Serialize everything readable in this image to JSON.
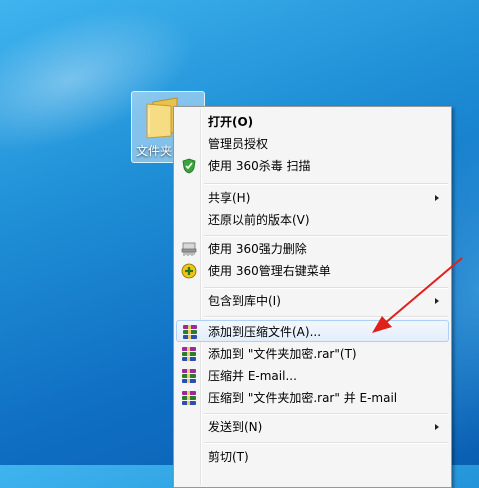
{
  "desktop": {
    "folder_label": "文件夹"
  },
  "menu": {
    "items": [
      {
        "label": "打开(O)",
        "bold": true,
        "icon": ""
      },
      {
        "label": "管理员授权",
        "icon": ""
      },
      {
        "label": "使用 360杀毒 扫描",
        "icon": "360-shield-icon"
      },
      {
        "label": "共享(H)",
        "icon": "",
        "submenu": true
      },
      {
        "label": "还原以前的版本(V)",
        "icon": ""
      },
      {
        "label": "使用 360强力删除",
        "icon": "360-shredder-icon"
      },
      {
        "label": "使用 360管理右键菜单",
        "icon": "360-menu-manager-icon"
      },
      {
        "label": "包含到库中(I)",
        "icon": "",
        "submenu": true
      },
      {
        "label": "添加到压缩文件(A)...",
        "icon": "winrar-icon",
        "highlighted": true
      },
      {
        "label": "添加到 \"文件夹加密.rar\"(T)",
        "icon": "winrar-icon"
      },
      {
        "label": "压缩并 E-mail...",
        "icon": "winrar-icon"
      },
      {
        "label": "压缩到 \"文件夹加密.rar\" 并 E-mail",
        "icon": "winrar-icon"
      },
      {
        "label": "发送到(N)",
        "icon": "",
        "submenu": true
      },
      {
        "label": "剪切(T)",
        "icon": ""
      }
    ]
  },
  "colors": {
    "highlight_border": "#aecff7",
    "annotation_arrow": "#e0201a"
  }
}
